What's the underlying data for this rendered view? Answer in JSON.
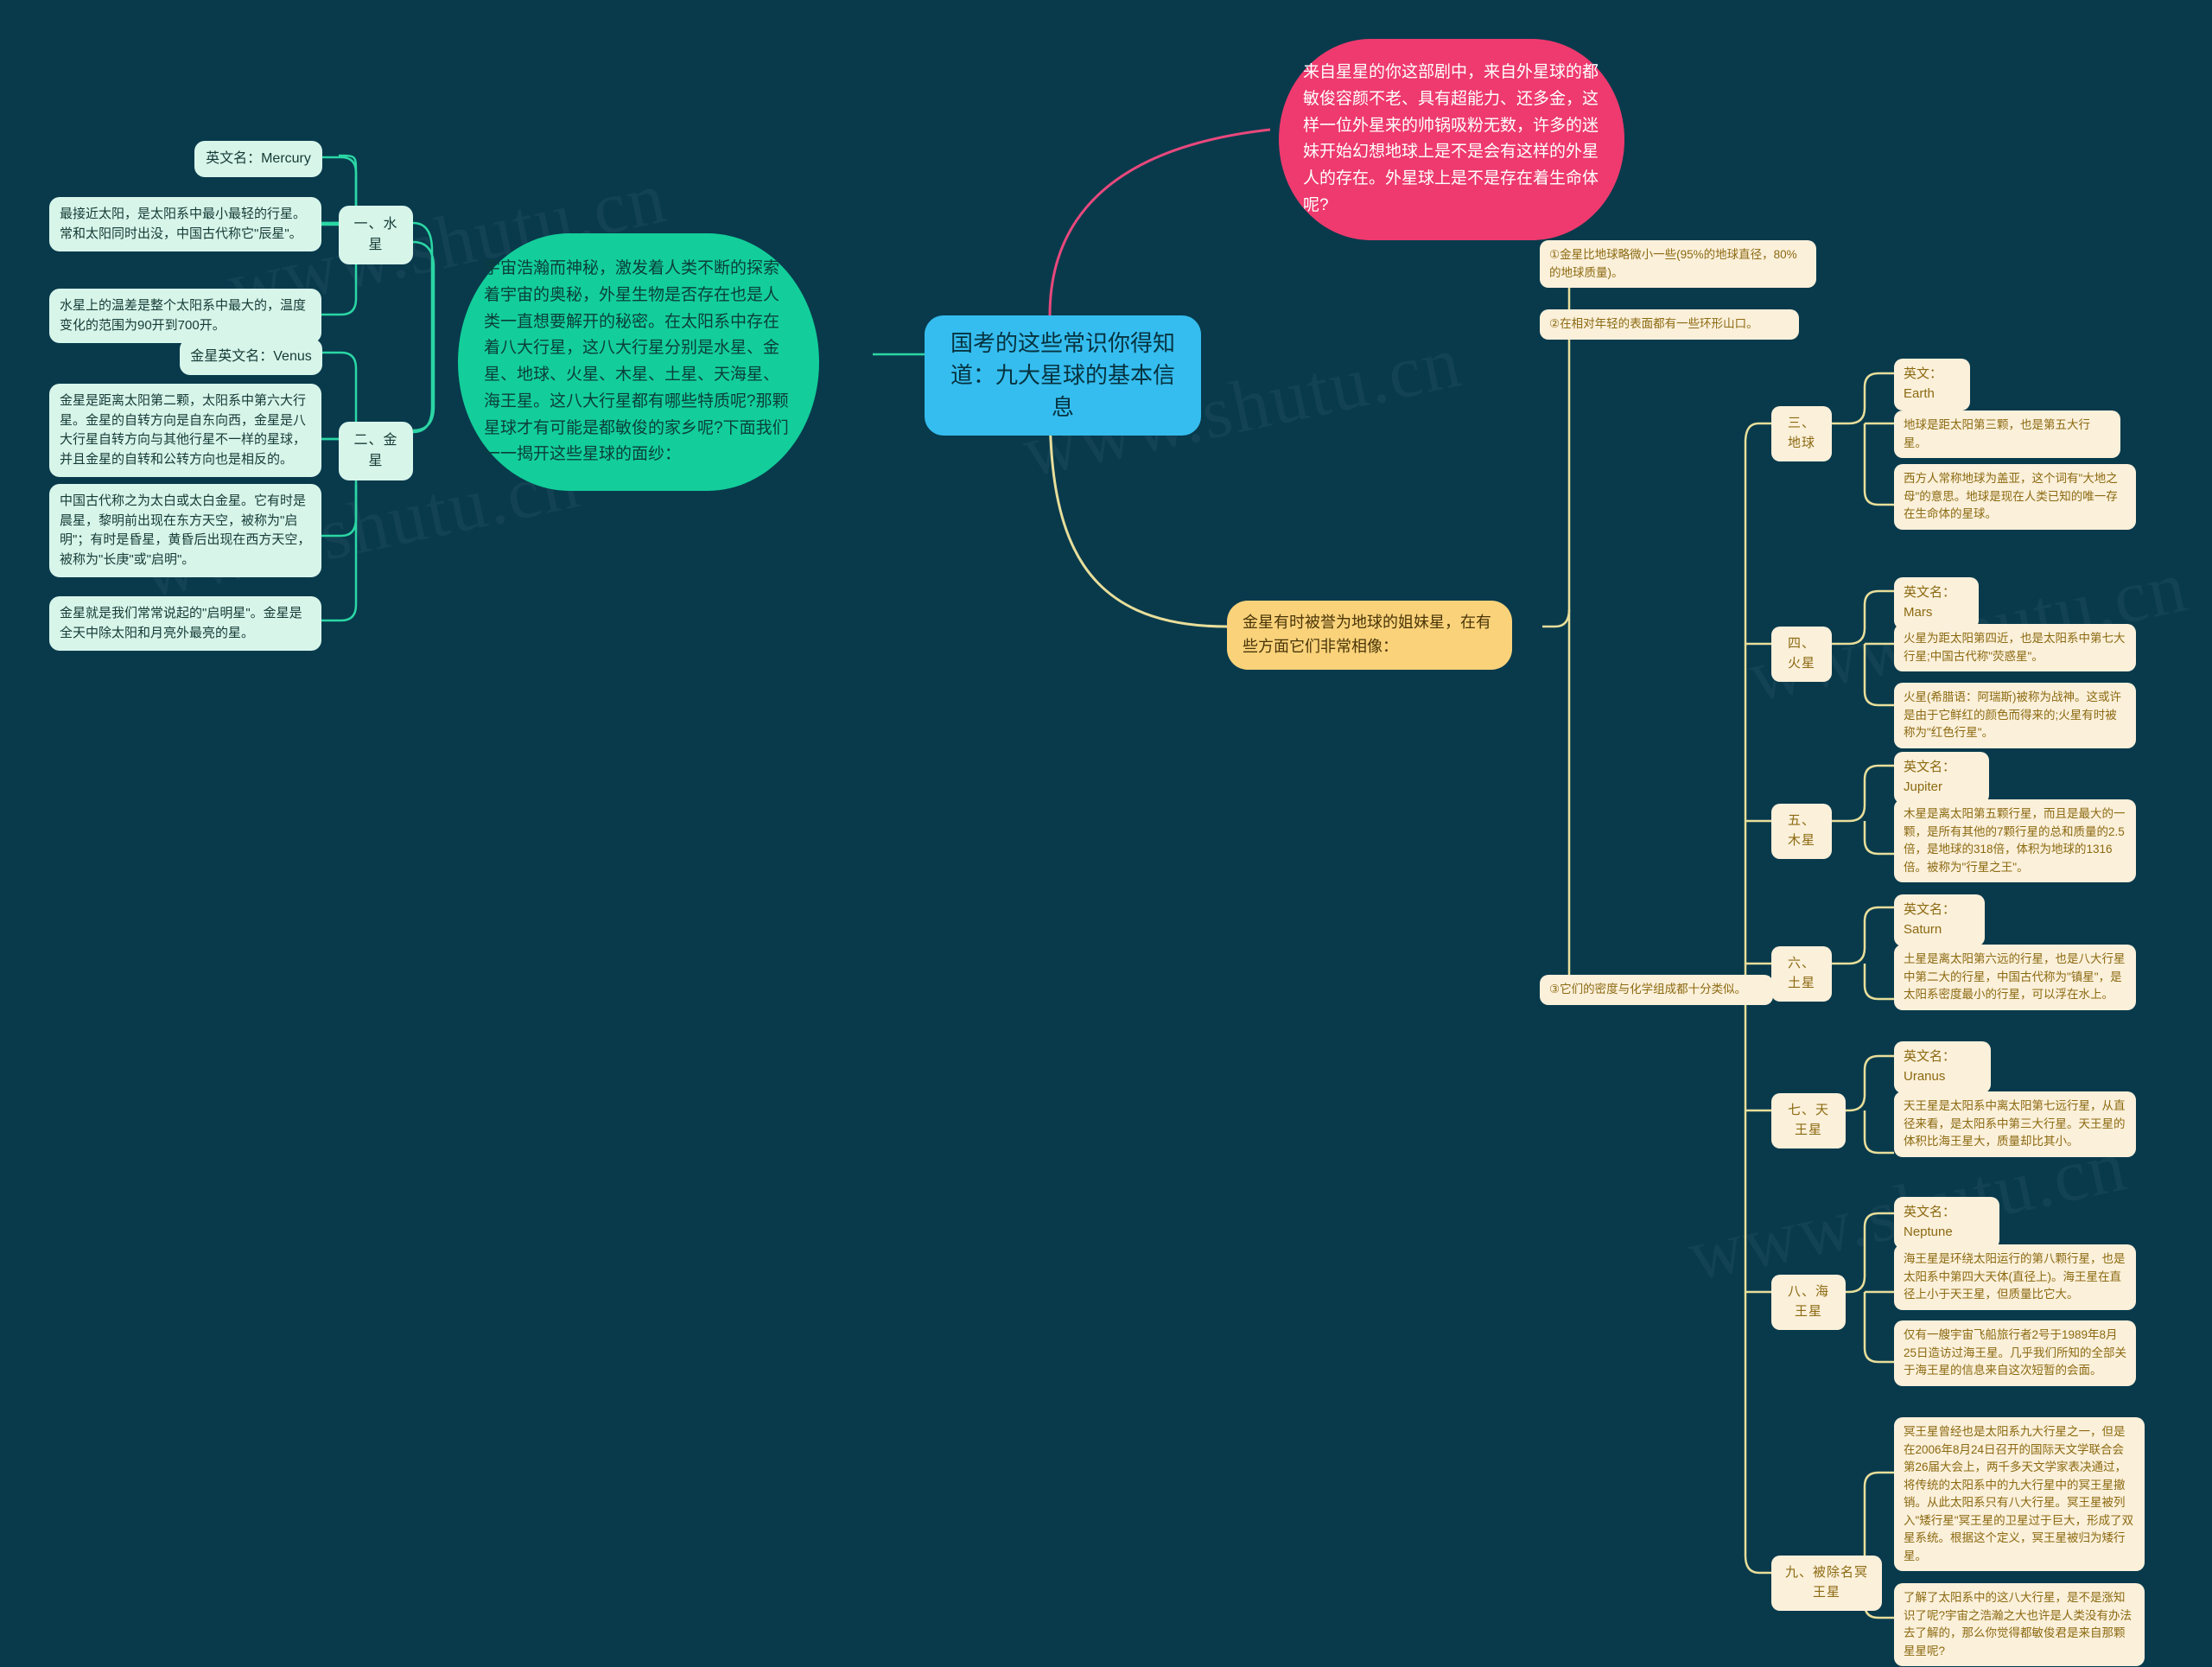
{
  "canvas": {
    "background": "#083A4C",
    "watermarks": [
      "www.shutu.cn",
      "www.shutu.cn",
      "www.shutu.cn",
      "www.shutu.cn",
      "www.shutu.cn"
    ]
  },
  "colors": {
    "central": "#35BDEF",
    "green": "#13CE9A",
    "pink": "#EE3A6E",
    "mint": "#D8F5EA",
    "cream": "#FBF0DA",
    "yellow": "#F9D27A",
    "gold_line": "#E8DE9A",
    "green_line": "#2BD6A4",
    "pink_line": "#E8487C"
  },
  "central": {
    "title": "国考的这些常识你得知道：九大星球的基本信息"
  },
  "intro": {
    "green_text": "宇宙浩瀚而神秘，激发着人类不断的探索着宇宙的奥秘，外星生物是否存在也是人类一直想要解开的秘密。在太阳系中存在着八大行星，这八大行星分别是水星、金星、地球、火星、木星、土星、天海星、海王星。这八大行星都有哪些特质呢?那颗星球才有可能是都敏俊的家乡呢?下面我们一一揭开这些星球的面纱：",
    "pink_text": "来自星星的你这部剧中，来自外星球的都敏俊容颜不老、具有超能力、还多金，这样一位外星来的帅锅吸粉无数，许多的迷妹开始幻想地球上是不是会有这样的外星人的存在。外星球上是不是存在着生命体呢?"
  },
  "left_branches": [
    {
      "topic": "一、水星",
      "items": [
        "英文名：Mercury",
        "最接近太阳，是太阳系中最小最轻的行星。常和太阳同时出没，中国古代称它\"辰星\"。",
        "水星上的温差是整个太阳系中最大的，温度变化的范围为90开到700开。"
      ]
    },
    {
      "topic": "二、金星",
      "items": [
        "金星英文名：Venus",
        "金星是距离太阳第二颗，太阳系中第六大行星。金星的自转方向是自东向西，金星是八大行星自转方向与其他行星不一样的星球，并且金星的自转和公转方向也是相反的。",
        "中国古代称之为太白或太白金星。它有时是晨星，黎明前出现在东方天空，被称为\"启明\"；有时是昏星，黄昏后出现在西方天空，被称为\"长庚\"或\"启明\"。",
        "金星就是我们常常说起的\"启明星\"。金星是全天中除太阳和月亮外最亮的星。"
      ]
    }
  ],
  "venus_sister": {
    "label": "金星有时被誉为地球的姐妹星，在有些方面它们非常相像：",
    "notes": [
      "①金星比地球略微小一些(95%的地球直径，80%的地球质量)。",
      "②在相对年轻的表面都有一些环形山口。",
      "③它们的密度与化学组成都十分类似。"
    ]
  },
  "right_branches": [
    {
      "topic": "三、地球",
      "items": [
        "英文：Earth",
        "地球是距太阳第三颗，也是第五大行星。",
        "西方人常称地球为盖亚，这个词有\"大地之母\"的意思。地球是现在人类已知的唯一存在生命体的星球。"
      ]
    },
    {
      "topic": "四、火星",
      "items": [
        "英文名：Mars",
        "火星为距太阳第四近，也是太阳系中第七大行星;中国古代称\"荧惑星\"。",
        "火星(希腊语：阿瑞斯)被称为战神。这或许是由于它鲜红的颜色而得来的;火星有时被称为\"红色行星\"。"
      ]
    },
    {
      "topic": "五、木星",
      "items": [
        "英文名：Jupiter",
        "木星是离太阳第五颗行星，而且是最大的一颗，是所有其他的7颗行星的总和质量的2.5倍，是地球的318倍，体积为地球的1316倍。被称为\"行星之王\"。"
      ]
    },
    {
      "topic": "六、土星",
      "items": [
        "英文名：Saturn",
        "土星是离太阳第六远的行星，也是八大行星中第二大的行星，中国古代称为\"镇星\"，是太阳系密度最小的行星，可以浮在水上。"
      ]
    },
    {
      "topic": "七、天王星",
      "items": [
        "英文名：Uranus",
        "天王星是太阳系中离太阳第七远行星，从直径来看，是太阳系中第三大行星。天王星的体积比海王星大，质量却比其小。"
      ]
    },
    {
      "topic": "八、海王星",
      "items": [
        "英文名：Neptune",
        "海王星是环绕太阳运行的第八颗行星，也是太阳系中第四大天体(直径上)。海王星在直径上小于天王星，但质量比它大。",
        "仅有一艘宇宙飞船旅行者2号于1989年8月25日造访过海王星。几乎我们所知的全部关于海王星的信息来自这次短暂的会面。"
      ]
    },
    {
      "topic": "九、被除名冥王星",
      "items": [
        "冥王星曾经也是太阳系九大行星之一，但是在2006年8月24日召开的国际天文学联合会第26届大会上，两千多天文学家表决通过，将传统的太阳系中的九大行星中的冥王星撤销。从此太阳系只有八大行星。冥王星被列入\"矮行星\"冥王星的卫星过于巨大，形成了双星系统。根据这个定义，冥王星被归为矮行星。",
        "了解了太阳系中的这八大行星，是不是涨知识了呢?宇宙之浩瀚之大也许是人类没有办法去了解的，那么你觉得都敏俊君是来自那颗星星呢?"
      ]
    }
  ]
}
